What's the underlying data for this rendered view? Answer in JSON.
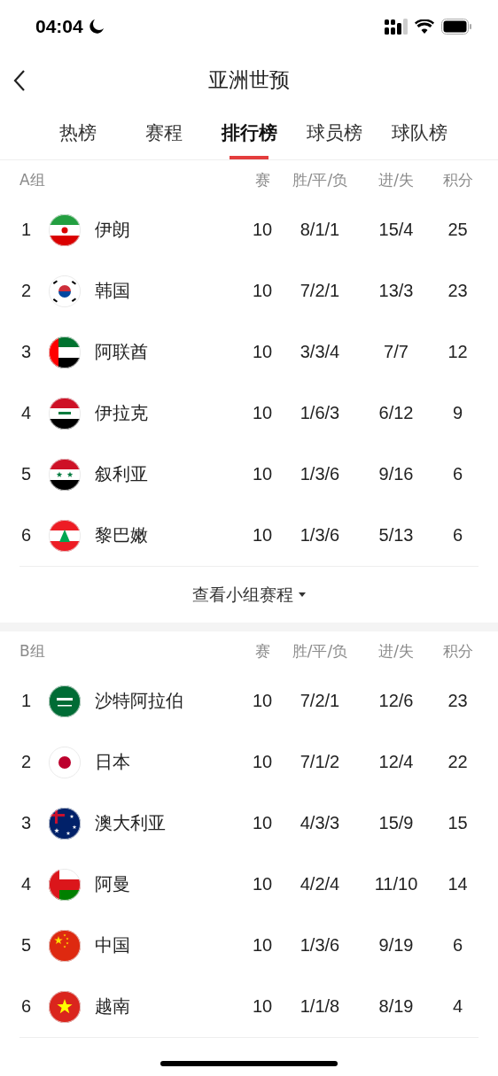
{
  "status_bar": {
    "time": "04:04"
  },
  "header": {
    "title": "亚洲世预"
  },
  "tabs": [
    {
      "label": "热榜",
      "selected": false
    },
    {
      "label": "赛程",
      "selected": false
    },
    {
      "label": "排行榜",
      "selected": true
    },
    {
      "label": "球员榜",
      "selected": false
    },
    {
      "label": "球队榜",
      "selected": false
    }
  ],
  "groups": [
    {
      "name": "A组",
      "columns": [
        "赛",
        "胜/平/负",
        "进/失",
        "积分"
      ],
      "rows": [
        {
          "rank": "1",
          "kind": "ir",
          "team": "伊朗",
          "played": "10",
          "wdl": "8/1/1",
          "goals": "15/4",
          "points": "25"
        },
        {
          "rank": "2",
          "kind": "kr",
          "team": "韩国",
          "played": "10",
          "wdl": "7/2/1",
          "goals": "13/3",
          "points": "23"
        },
        {
          "rank": "3",
          "kind": "ae",
          "team": "阿联酋",
          "played": "10",
          "wdl": "3/3/4",
          "goals": "7/7",
          "points": "12"
        },
        {
          "rank": "4",
          "kind": "iq",
          "team": "伊拉克",
          "played": "10",
          "wdl": "1/6/3",
          "goals": "6/12",
          "points": "9"
        },
        {
          "rank": "5",
          "kind": "sy",
          "team": "叙利亚",
          "played": "10",
          "wdl": "1/3/6",
          "goals": "9/16",
          "points": "6"
        },
        {
          "rank": "6",
          "kind": "lb",
          "team": "黎巴嫩",
          "played": "10",
          "wdl": "1/3/6",
          "goals": "5/13",
          "points": "6"
        }
      ],
      "link": "查看小组赛程"
    },
    {
      "name": "B组",
      "columns": [
        "赛",
        "胜/平/负",
        "进/失",
        "积分"
      ],
      "rows": [
        {
          "rank": "1",
          "kind": "sa",
          "team": "沙特阿拉伯",
          "played": "10",
          "wdl": "7/2/1",
          "goals": "12/6",
          "points": "23"
        },
        {
          "rank": "2",
          "kind": "jp",
          "team": "日本",
          "played": "10",
          "wdl": "7/1/2",
          "goals": "12/4",
          "points": "22"
        },
        {
          "rank": "3",
          "kind": "au",
          "team": "澳大利亚",
          "played": "10",
          "wdl": "4/3/3",
          "goals": "15/9",
          "points": "15"
        },
        {
          "rank": "4",
          "kind": "om",
          "team": "阿曼",
          "played": "10",
          "wdl": "4/2/4",
          "goals": "11/10",
          "points": "14"
        },
        {
          "rank": "5",
          "kind": "cn",
          "team": "中国",
          "played": "10",
          "wdl": "1/3/6",
          "goals": "9/19",
          "points": "6"
        },
        {
          "rank": "6",
          "kind": "vn",
          "team": "越南",
          "played": "10",
          "wdl": "1/1/8",
          "goals": "8/19",
          "points": "4"
        }
      ]
    }
  ]
}
